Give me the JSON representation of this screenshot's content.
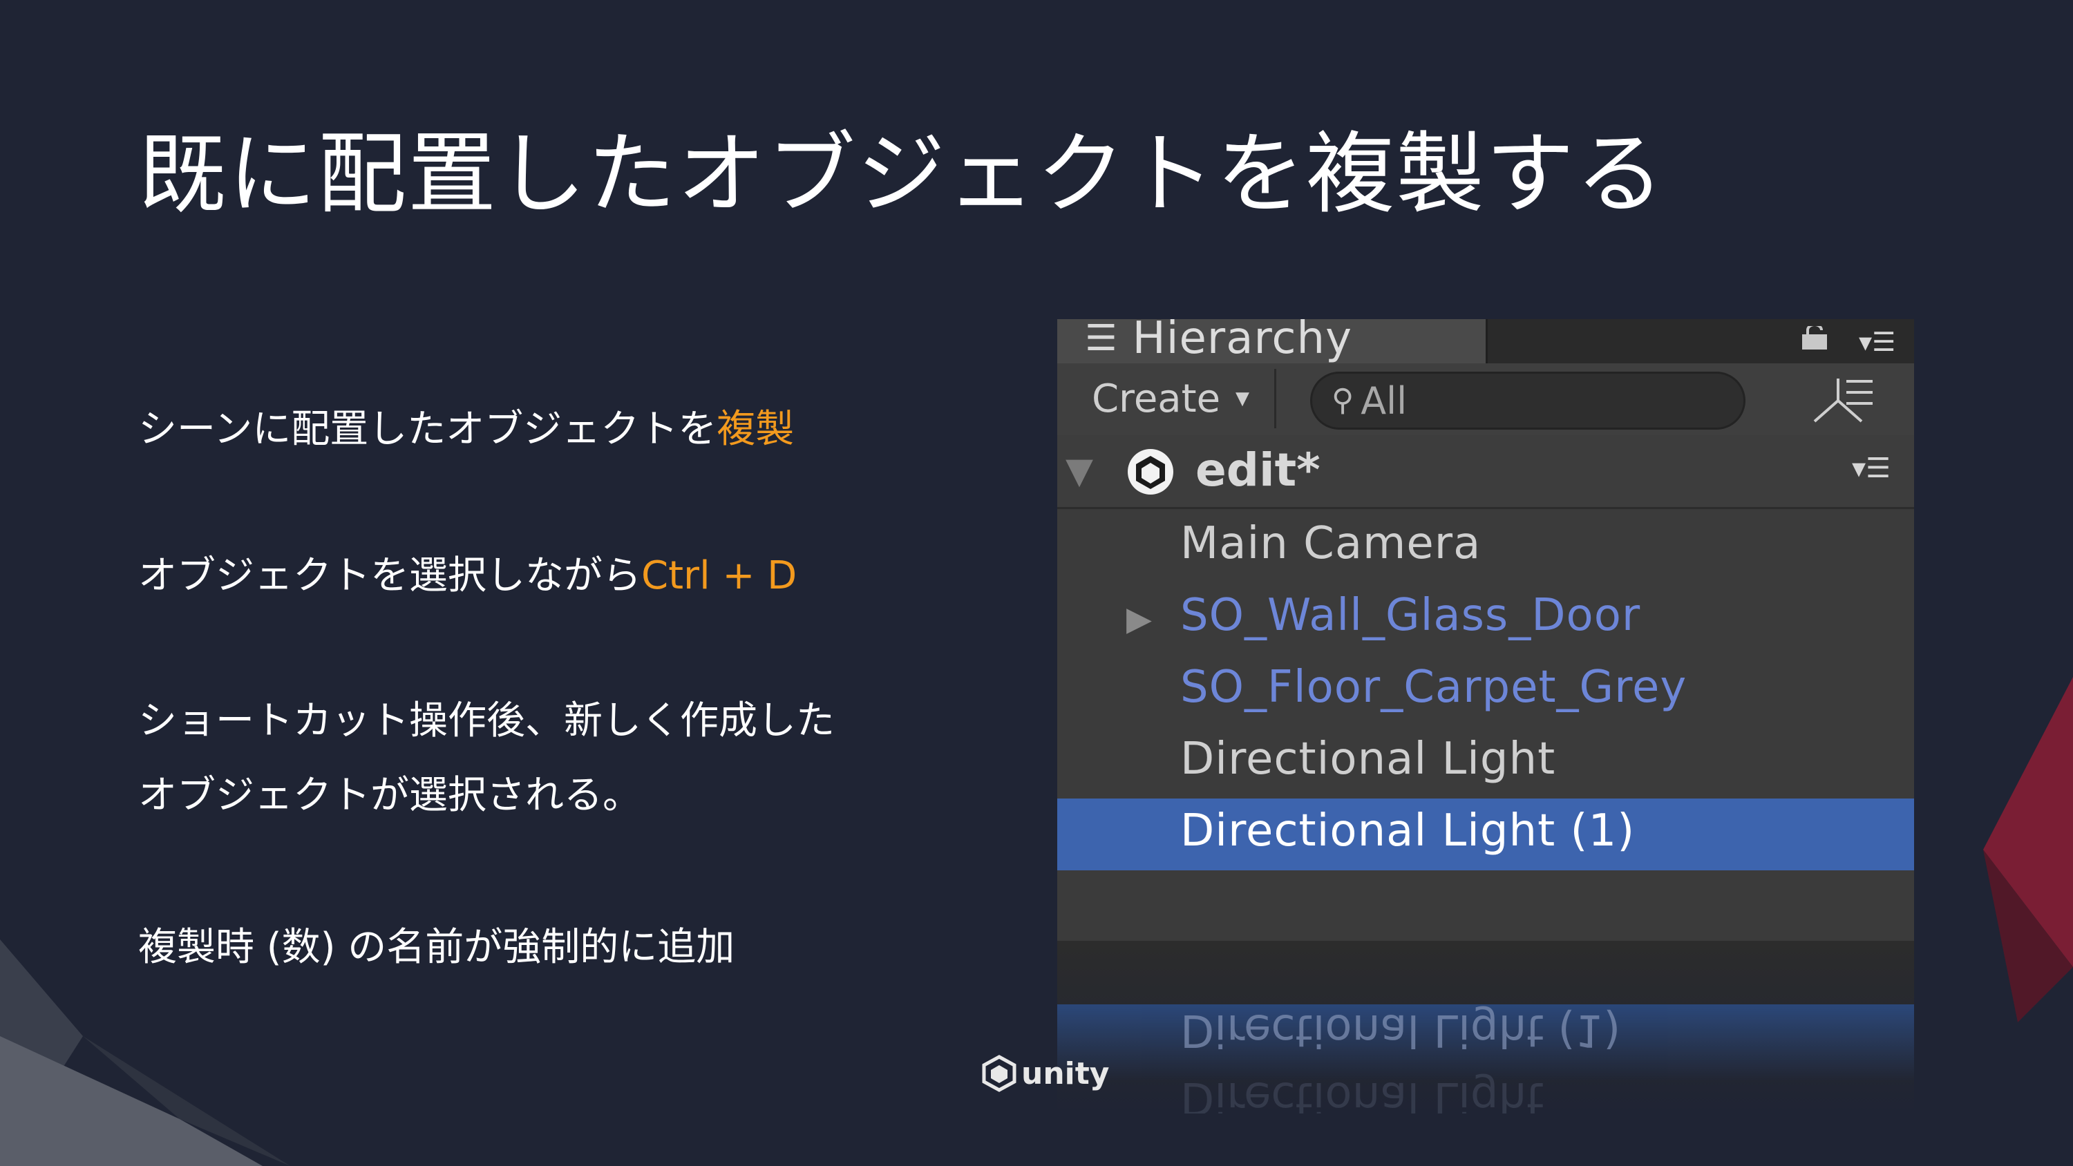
{
  "slide": {
    "title": "既に配置したオブジェクトを複製する",
    "bullets": {
      "b1_text": "シーンに配置したオブジェクトを",
      "b1_accent": "複製",
      "b2_text": "オブジェクトを選択しながら",
      "b2_accent": "Ctrl + D",
      "b3_line1": "ショートカット操作後、新しく作成した",
      "b3_line2": "オブジェクトが選択される。",
      "b4_text": "複製時 (数) の名前が強制的に追加"
    },
    "accent_color": "#f39a1e",
    "logo_text": "unity"
  },
  "hierarchy": {
    "tab_label": "Hierarchy",
    "create_label": "Create",
    "search_placeholder": "All",
    "scene_name": "edit*",
    "items": [
      {
        "label": "Main Camera",
        "type": "object",
        "selected": false
      },
      {
        "label": "SO_Wall_Glass_Door",
        "type": "prefab",
        "selected": false,
        "has_children": true
      },
      {
        "label": "SO_Floor_Carpet_Grey",
        "type": "prefab",
        "selected": false
      },
      {
        "label": "Directional Light",
        "type": "object",
        "selected": false
      },
      {
        "label": "Directional Light (1)",
        "type": "object",
        "selected": true
      }
    ],
    "colors": {
      "prefab_text": "#6d86d8",
      "selection": "#3d64ae"
    }
  }
}
